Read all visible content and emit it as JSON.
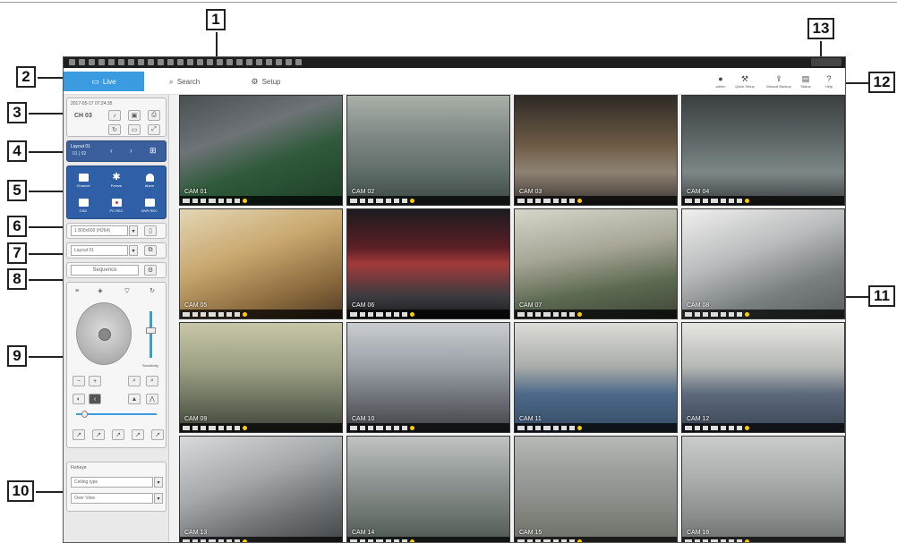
{
  "callouts": [
    "1",
    "2",
    "3",
    "4",
    "5",
    "6",
    "7",
    "8",
    "9",
    "10",
    "11",
    "12",
    "13"
  ],
  "tabs": [
    {
      "label": "Live",
      "icon": "monitor-icon",
      "active": true
    },
    {
      "label": "Search",
      "icon": "search-icon",
      "active": false
    },
    {
      "label": "Setup",
      "icon": "gear-icon",
      "active": false
    }
  ],
  "toolbar": [
    {
      "label": "admin",
      "icon": "user-icon"
    },
    {
      "label": "Quick Setup",
      "icon": "wrench-icon"
    },
    {
      "label": "Manual Backup",
      "icon": "backup-icon"
    },
    {
      "label": "Status",
      "icon": "status-icon"
    },
    {
      "label": "Help",
      "icon": "help-icon"
    }
  ],
  "channel_info": {
    "datetime": "2017-05-17  07:24:35",
    "channel": "CH 03"
  },
  "layout_box": {
    "label": "Layout 01",
    "page": "01 | 02"
  },
  "quick_buttons": [
    {
      "label": "Channel",
      "icon": "channel-icon"
    },
    {
      "label": "Freeze",
      "icon": "freeze-icon"
    },
    {
      "label": "Alarm",
      "icon": "alarm-icon"
    },
    {
      "label": "OSD",
      "icon": "osd-icon"
    },
    {
      "label": "PC REC",
      "icon": "pc-rec-icon"
    },
    {
      "label": "NVR REC",
      "icon": "nvr-rec-icon"
    }
  ],
  "resolution_select": "1 800x600 (H264)",
  "layout_select": "Layout 01",
  "sequence_label": "Sequence",
  "ptz": {
    "speed_label": "Sensitivity"
  },
  "fisheye": {
    "title": "Fisheye",
    "mount": "Ceiling type",
    "view": "Over View"
  },
  "cameras": [
    "CAM 01",
    "CAM 02",
    "CAM 03",
    "CAM 04",
    "CAM 05",
    "CAM 06",
    "CAM 07",
    "CAM 08",
    "CAM 09",
    "CAM 10",
    "CAM 11",
    "CAM 12",
    "CAM 13",
    "CAM 14",
    "CAM 15",
    "CAM 16"
  ],
  "colors": {
    "accent": "#3a9be0",
    "titlebar": "#1e1e1e",
    "quick_panel": "#2f5fa6"
  }
}
